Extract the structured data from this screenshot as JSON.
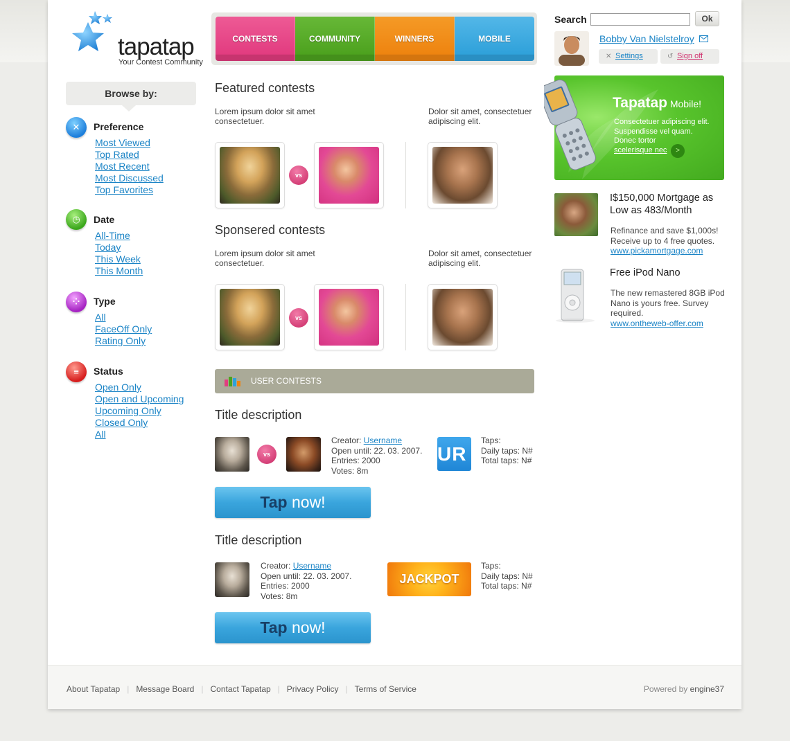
{
  "brand": {
    "name": "tapatap",
    "tagline": "Your Contest Community"
  },
  "nav": {
    "tabs": [
      "CONTESTS",
      "COMMUNITY",
      "WINNERS",
      "MOBILE"
    ]
  },
  "search": {
    "label": "Search",
    "value": "",
    "button": "Ok"
  },
  "user": {
    "name": "Bobby Van Nielstelroy",
    "settings": "Settings",
    "signoff": "Sign off"
  },
  "sidebar": {
    "browse_label": "Browse by:",
    "groups": [
      {
        "title": "Preference",
        "items": [
          "Most Viewed",
          "Top Rated",
          "Most Recent",
          "Most Discussed",
          "Top Favorites"
        ]
      },
      {
        "title": "Date",
        "items": [
          "All-Time",
          "Today",
          "This Week",
          "This Month"
        ]
      },
      {
        "title": "Type",
        "items": [
          "All",
          "FaceOff Only",
          "Rating Only"
        ]
      },
      {
        "title": "Status",
        "items": [
          "Open Only",
          "Open and Upcoming",
          "Upcoming Only",
          "Closed Only",
          "All"
        ]
      }
    ]
  },
  "featured": {
    "title": "Featured contests",
    "left_text": [
      "Lorem ipsum dolor sit amet",
      "consectetuer."
    ],
    "right_text": [
      "Dolor sit amet, consectetuer",
      "adipiscing elit."
    ],
    "vs": "vs"
  },
  "sponsored": {
    "title": "Sponsered contests",
    "left_text": [
      "Lorem ipsum dolor sit amet",
      "consectetuer."
    ],
    "right_text": [
      "Dolor sit amet, consectetuer",
      "adipiscing elit."
    ],
    "vs": "vs"
  },
  "user_contests": {
    "header": "USER CONTESTS",
    "items": [
      {
        "title": "Title description",
        "creator_label": "Creator:",
        "creator": "Username",
        "open_until": "Open until:  22. 03. 2007.",
        "entries": "Entries: 2000",
        "votes": "Votes: 8m",
        "badge": "UR F",
        "taps": "Taps:",
        "daily_taps": "Daily taps: N#",
        "total_taps": "Total taps: N#",
        "vs": "vs",
        "button_bold": "Tap",
        "button_rest": " now!"
      },
      {
        "title": "Title description",
        "creator_label": "Creator:",
        "creator": "Username",
        "open_until": "Open until:  22. 03. 2007.",
        "entries": "Entries: 2000",
        "votes": "Votes: 8m",
        "badge": "JACKPOT",
        "taps": "Taps:",
        "daily_taps": "Daily taps: N#",
        "total_taps": "Total taps: N#",
        "button_bold": "Tap",
        "button_rest": " now!"
      }
    ]
  },
  "promo": {
    "title": "Tapatap",
    "title_suffix": " Mobile!",
    "lines": [
      "Consectetuer adipiscing elit.",
      "Suspendisse vel quam.",
      "Donec tortor"
    ],
    "link": "scelerisque nec",
    "go": ">"
  },
  "ads": [
    {
      "title": [
        "I$150,000 Mortgage as",
        "Low as 483/Month"
      ],
      "text": [
        "Refinance and save $1,000s!",
        "Receive up to 4 free quotes."
      ],
      "link": "www.pickamortgage.com"
    },
    {
      "title": [
        "Free iPod Nano"
      ],
      "text": [
        "The new remastered 8GB iPod",
        "Nano is yours free. Survey",
        "required."
      ],
      "link": "www.ontheweb-offer.com"
    }
  ],
  "footer": {
    "links": [
      "About Tapatap",
      "Message Board",
      "Contact Tapatap",
      "Privacy Policy",
      "Terms of Service"
    ],
    "powered_prefix": "Powered by ",
    "powered_name": "engine37"
  }
}
